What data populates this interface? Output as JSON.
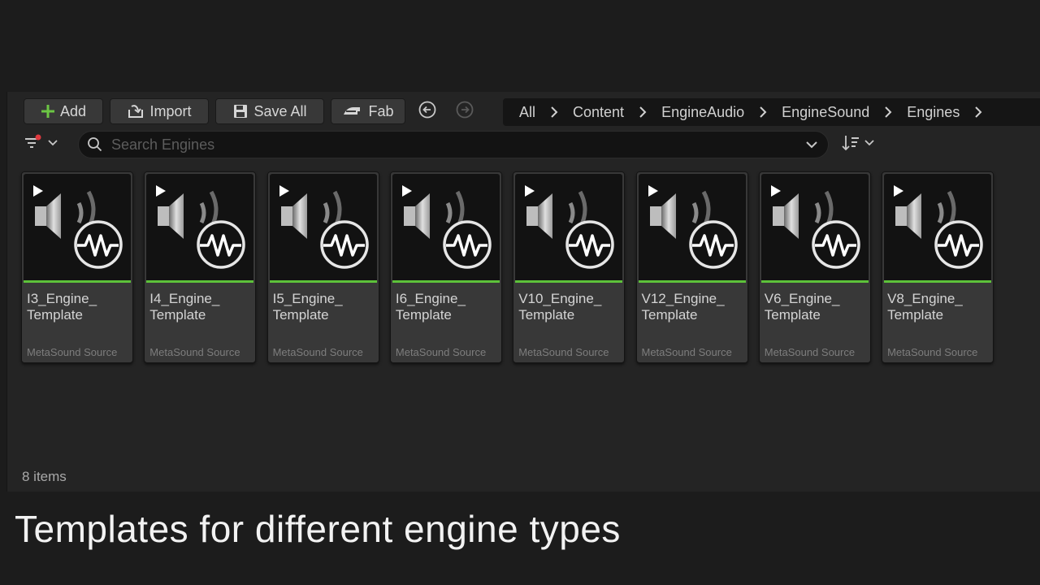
{
  "toolbar": {
    "add_label": "Add",
    "import_label": "Import",
    "save_all_label": "Save All",
    "fab_label": "Fab"
  },
  "breadcrumb": [
    "All",
    "Content",
    "EngineAudio",
    "EngineSound",
    "Engines"
  ],
  "search": {
    "placeholder": "Search Engines",
    "value": ""
  },
  "assets": [
    {
      "name": "I3_Engine_\nTemplate",
      "type": "MetaSound Source"
    },
    {
      "name": "I4_Engine_\nTemplate",
      "type": "MetaSound Source"
    },
    {
      "name": "I5_Engine_\nTemplate",
      "type": "MetaSound Source"
    },
    {
      "name": "I6_Engine_\nTemplate",
      "type": "MetaSound Source"
    },
    {
      "name": "V10_Engine_\nTemplate",
      "type": "MetaSound Source"
    },
    {
      "name": "V12_Engine_\nTemplate",
      "type": "MetaSound Source"
    },
    {
      "name": "V6_Engine_\nTemplate",
      "type": "MetaSound Source"
    },
    {
      "name": "V8_Engine_\nTemplate",
      "type": "MetaSound Source"
    }
  ],
  "status": {
    "item_count": "8 items"
  },
  "caption": "Templates for different engine types",
  "colors": {
    "accent_green": "#5dc23a",
    "filter_dot_red": "#e0393e"
  },
  "icons": {
    "add": "plus-icon",
    "import": "import-icon",
    "save_all": "save-icon",
    "fab": "fab-icon",
    "back": "back-arrow-icon",
    "forward": "forward-arrow-icon",
    "crumb_separator": "chevron-right-icon",
    "search": "search-icon",
    "filter": "filter-icon",
    "sort": "sort-icon",
    "asset": "metasound-icon"
  }
}
